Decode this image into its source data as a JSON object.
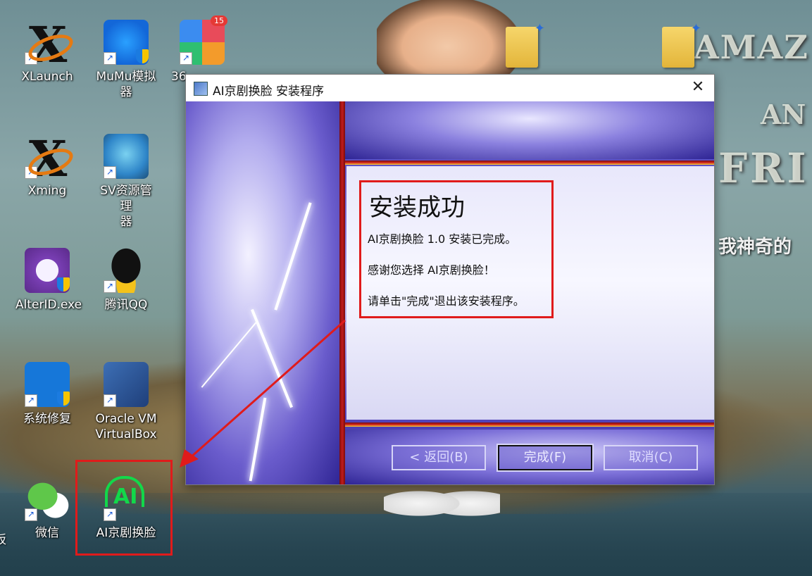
{
  "desktop": {
    "icons": [
      {
        "label": "XLaunch"
      },
      {
        "label": "MuMu模拟\n器"
      },
      {
        "label": "36"
      },
      {
        "label": "Xming"
      },
      {
        "label": "SV资源管理\n器"
      },
      {
        "label": "AlterID.exe"
      },
      {
        "label": "腾讯QQ"
      },
      {
        "label": "系统修复"
      },
      {
        "label": "Oracle VM\nVirtualBox"
      },
      {
        "label": "微信"
      },
      {
        "label": "AI京剧换脸"
      }
    ],
    "badge_count": "15",
    "wallpaper_text": {
      "line1": "AMAZ",
      "line2": "AN",
      "line3": "FRI",
      "subtitle": "我神奇的"
    },
    "left_edge_fragment": "坂"
  },
  "installer": {
    "title": "AI京剧换脸 安装程序",
    "close_glyph": "✕",
    "heading": "安装成功",
    "lines": [
      "AI京剧换脸 1.0 安装已完成。",
      "感谢您选择 AI京剧换脸！",
      "请单击\"完成\"退出该安装程序。"
    ],
    "buttons": {
      "back": "< 返回(B)",
      "finish": "完成(F)",
      "cancel": "取消(C)"
    }
  },
  "ai_icon_text": "AI",
  "colors": {
    "annotation": "#e01b1b",
    "ai_green": "#12d84a"
  }
}
